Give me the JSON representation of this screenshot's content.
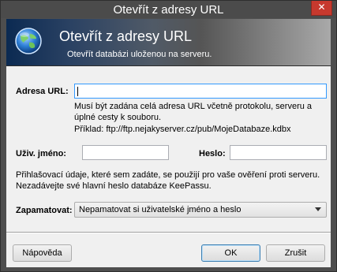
{
  "window": {
    "title": "Otevřít z adresy URL",
    "close_glyph": "✕"
  },
  "banner": {
    "title": "Otevřít z adresy URL",
    "subtitle": "Otevřít databázi uloženou na serveru.",
    "icon": "globe-icon"
  },
  "form": {
    "url_label": "Adresa URL:",
    "url_value": "",
    "url_help_line1": "Musí být zadána celá adresa URL včetně protokolu, serveru a",
    "url_help_line2": "úplné cesty k souboru.",
    "url_example": "Příklad: ftp://ftp.nejakyserver.cz/pub/MojeDatabaze.kdbx",
    "username_label": "Uživ. jméno:",
    "username_value": "",
    "password_label": "Heslo:",
    "password_value": "",
    "credentials_note_line1": "Přihlašovací údaje, které sem zadáte, se použijí pro vaše ověření proti serveru.",
    "credentials_note_line2": "Nezadávejte své hlavní heslo databáze KeePassu.",
    "remember_label": "Zapamatovat:",
    "remember_selected": "Nepamatovat si uživatelské jméno a heslo"
  },
  "buttons": {
    "help": "Nápověda",
    "ok": "OK",
    "cancel": "Zrušit"
  }
}
